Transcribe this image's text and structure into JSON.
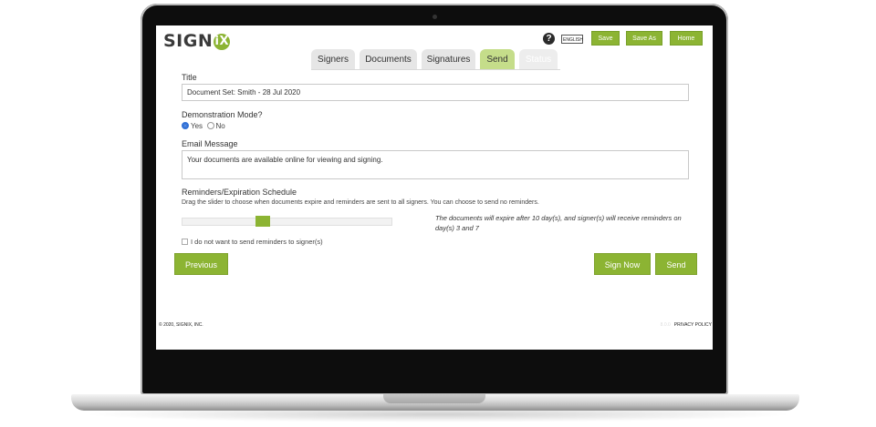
{
  "header": {
    "logo": "SIGNiX",
    "help_label": "?",
    "language": "ENGLISH",
    "buttons": {
      "save": "Save",
      "save_as": "Save As",
      "home": "Home"
    }
  },
  "tabs": [
    {
      "label": "Signers",
      "state": "normal"
    },
    {
      "label": "Documents",
      "state": "normal"
    },
    {
      "label": "Signatures",
      "state": "normal"
    },
    {
      "label": "Send",
      "state": "active"
    },
    {
      "label": "Status",
      "state": "disabled"
    }
  ],
  "form": {
    "title_label": "Title",
    "title_value": "Document Set: Smith - 28 Jul 2020",
    "demo_label": "Demonstration Mode?",
    "demo_yes": "Yes",
    "demo_no": "No",
    "demo_selected": "Yes",
    "email_label": "Email Message",
    "email_value": "Your documents are available online for viewing and signing.",
    "reminders_label": "Reminders/Expiration Schedule",
    "reminders_help": "Drag the slider to choose when documents expire and reminders are sent to all signers. You can choose to send no reminders.",
    "expiry_text": "The documents will expire after 10 day(s), and signer(s) will receive reminders on day(s) 3 and 7",
    "no_reminders_label": "I do not want to send reminders to signer(s)",
    "no_reminders_checked": false
  },
  "actions": {
    "previous": "Previous",
    "sign_now": "Sign Now",
    "send": "Send"
  },
  "footer": {
    "copyright": "© 2020, SIGNIX, INC.",
    "version": "8.0.0",
    "privacy": "PRIVACY POLICY"
  },
  "colors": {
    "accent": "#8cb433",
    "active_tab": "#c5dd8a",
    "radio": "#2f6fd6"
  }
}
